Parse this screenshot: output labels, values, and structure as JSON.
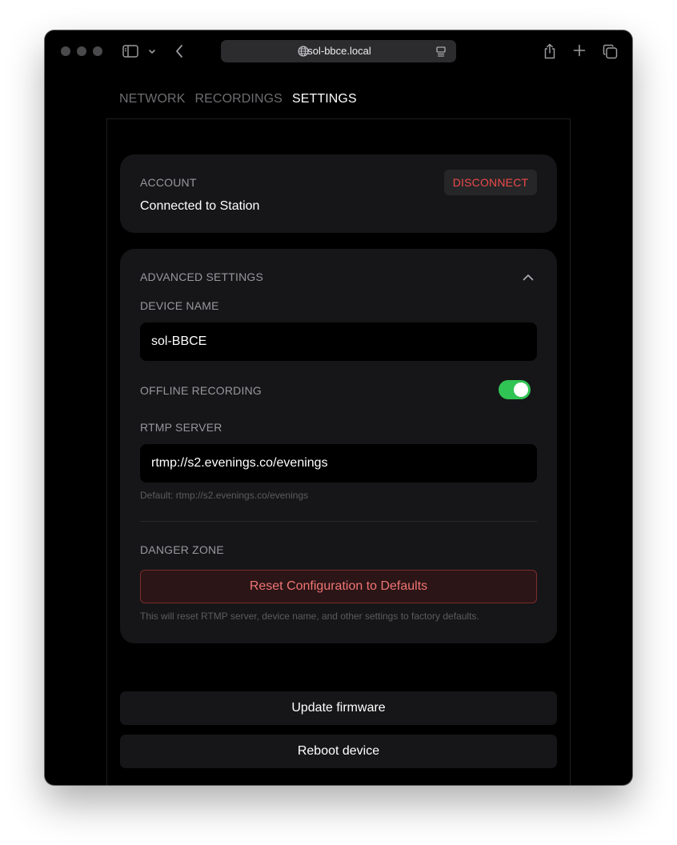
{
  "browser": {
    "url": "sol-bbce.local",
    "icons": {
      "sidebar": "sidebar-icon",
      "chevron": "chevron-down-icon",
      "back": "back-arrow-icon",
      "globe": "globe-icon",
      "reader": "reader-icon",
      "share": "share-icon",
      "new_tab": "plus-icon",
      "tabs": "tab-overview-icon"
    }
  },
  "nav": {
    "tabs": [
      {
        "label": "NETWORK",
        "active": false
      },
      {
        "label": "RECORDINGS",
        "active": false
      },
      {
        "label": "SETTINGS",
        "active": true
      }
    ]
  },
  "account": {
    "heading": "ACCOUNT",
    "status": "Connected to Station",
    "disconnect_label": "DISCONNECT"
  },
  "advanced": {
    "heading": "ADVANCED SETTINGS",
    "expanded": true,
    "device_name_label": "DEVICE NAME",
    "device_name_value": "sol-BBCE",
    "offline_recording_label": "OFFLINE RECORDING",
    "offline_recording_enabled": true,
    "rtmp_label": "RTMP SERVER",
    "rtmp_value": "rtmp://s2.evenings.co/evenings",
    "rtmp_default_hint": "Default: rtmp://s2.evenings.co/evenings",
    "danger_label": "DANGER ZONE",
    "reset_label": "Reset Configuration to Defaults",
    "reset_hint": "This will reset RTMP server, device name, and other settings to factory defaults."
  },
  "actions": {
    "update_firmware_label": "Update firmware",
    "reboot_label": "Reboot device"
  },
  "colors": {
    "accent_danger": "#ef4a4a",
    "toggle_on": "#30c454",
    "card_bg": "#161618",
    "window_bg": "#000000"
  }
}
